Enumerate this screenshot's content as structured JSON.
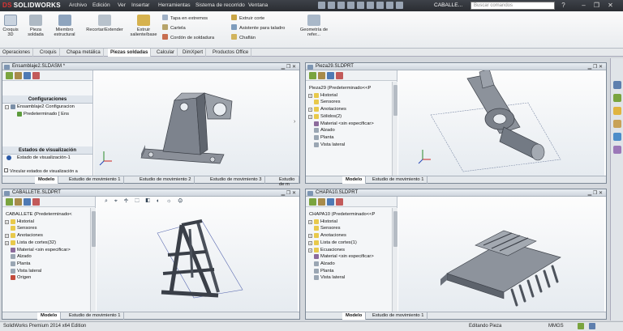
{
  "titlebar": {
    "logo_brand": "DS",
    "logo_text": "SOLIDWORKS",
    "menus": [
      "Archivo",
      "Edición",
      "Ver",
      "Insertar",
      "Herramientas",
      "Sistema de recorrido",
      "Ventana"
    ],
    "doc_title": "CABALLE...",
    "search_placeholder": "Buscar comandos"
  },
  "ribbon": {
    "big": [
      {
        "label": "Croquis 3D",
        "icon": "sketch-3d-icon"
      },
      {
        "label": "Pieza soldada",
        "icon": "weldment-icon"
      },
      {
        "label": "Miembro estructural",
        "icon": "structural-member-icon"
      },
      {
        "label": "Recortar/Extender",
        "icon": "trim-extend-icon"
      },
      {
        "label": "Extruir saliente/base",
        "icon": "extrude-boss-icon"
      }
    ],
    "small_col1": [
      "Tapa en extremos",
      "Cartela",
      "Cordón de soldadura"
    ],
    "small_col2": [
      "Extruir corte",
      "Asistente para taladro",
      "Chaflán"
    ],
    "geometry": "Geometría de refer..."
  },
  "tabs": [
    "Operaciones",
    "Croquis",
    "Chapa metálica",
    "Piezas soldadas",
    "Calcular",
    "DimXpert",
    "Productos Office"
  ],
  "active_tab": "Piezas soldadas",
  "windows": {
    "w1": {
      "title": "Ensamblaje2.SLDASM *",
      "config_header": "Configuraciones",
      "tree": [
        "Ensamblaje2 Configuracion",
        "Predeterminado [ Ens"
      ],
      "vis_header": "Estados de visualización",
      "vis_item": "Estado de visualización-1",
      "checkbox": "Vincular estados de visualización a",
      "bottom_tabs": [
        "Modelo",
        "Estudio de movimiento 1",
        "Estudio de movimiento 2",
        "Estudio de movimiento 3",
        "Estudio de m"
      ]
    },
    "w2": {
      "title": "Pieza29.SLDPRT",
      "tree": [
        "Pieza29 (Predeterminado<<P",
        "Historial",
        "Sensores",
        "Anotaciones",
        "Sólidos(2)",
        "Material <sin especificar>",
        "Alzado",
        "Planta",
        "Vista lateral"
      ],
      "bottom_tabs": [
        "Modelo",
        "Estudio de movimiento 1"
      ]
    },
    "w3": {
      "title": "CABALLETE.SLDPRT",
      "tree": [
        "CABALLETE (Predeterminado<",
        "Historial",
        "Sensores",
        "Anotaciones",
        "Lista de cortes(32)",
        "Material <sin especificar>",
        "Alzado",
        "Planta",
        "Vista lateral",
        "Origen"
      ],
      "bottom_tabs": [
        "Modelo",
        "Estudio de movimiento 1"
      ]
    },
    "w4": {
      "title": "CHAPA10.SLDPRT",
      "tree": [
        "CHAPA10 (Predeterminado<<P",
        "Historial",
        "Sensores",
        "Anotaciones",
        "Lista de cortes(1)",
        "Ecuaciones",
        "Material <sin especificar>",
        "Alzado",
        "Planta",
        "Vista lateral"
      ],
      "bottom_tabs": [
        "Modelo",
        "Estudio de movimiento 1"
      ]
    }
  },
  "status": {
    "left": "SolidWorks Premium 2014 x64 Edition",
    "mode": "Editando Pieza",
    "units": "MMGS"
  },
  "colors": {
    "accent": "#2f5d9a",
    "titlebar": "#2f3238",
    "model": "#6e7580",
    "folder": "#e8c94b"
  }
}
